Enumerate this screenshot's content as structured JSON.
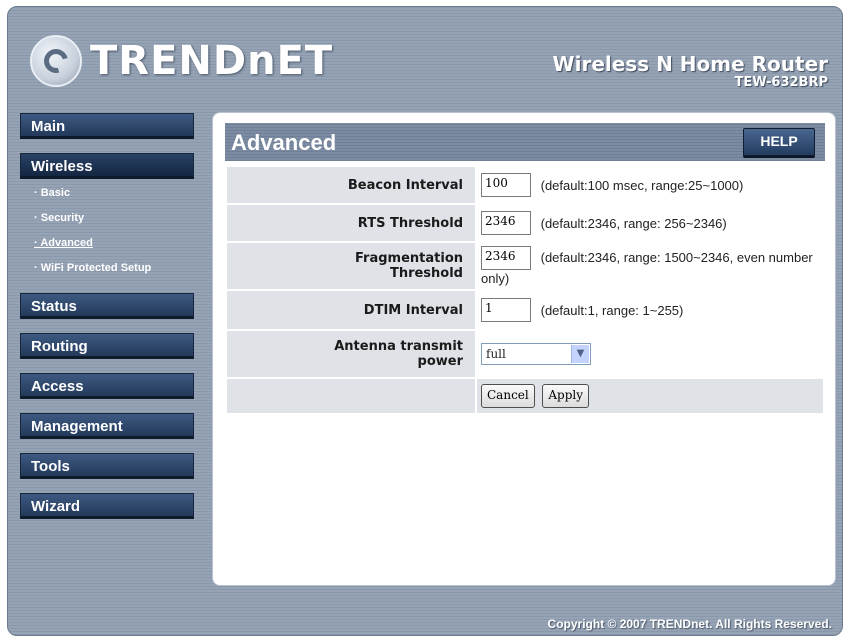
{
  "brand": {
    "logo_text": "TRENDnET",
    "product_name": "Wireless N Home Router",
    "model": "TEW-632BRP"
  },
  "sidebar": {
    "items": [
      {
        "label": "Main"
      },
      {
        "label": "Wireless",
        "sub": [
          "Basic",
          "Security",
          "Advanced",
          "WiFi Protected Setup"
        ]
      },
      {
        "label": "Status"
      },
      {
        "label": "Routing"
      },
      {
        "label": "Access"
      },
      {
        "label": "Management"
      },
      {
        "label": "Tools"
      },
      {
        "label": "Wizard"
      }
    ]
  },
  "panel": {
    "title": "Advanced",
    "help_label": "HELP"
  },
  "settings": [
    {
      "label": "Beacon Interval",
      "value": "100",
      "hint": "(default:100 msec, range:25~1000)"
    },
    {
      "label": "RTS Threshold",
      "value": "2346",
      "hint": "(default:2346, range: 256~2346)"
    },
    {
      "label": "Fragmentation Threshold",
      "value": "2346",
      "hint": "(default:2346, range: 1500~2346, even number only)"
    },
    {
      "label": "DTIM Interval",
      "value": "1",
      "hint": "(default:1, range: 1~255)"
    },
    {
      "label": "Antenna transmit power",
      "value": "full"
    }
  ],
  "actions": {
    "cancel": "Cancel",
    "apply": "Apply"
  },
  "footer": {
    "copyright": "Copyright © 2007 TRENDnet. All Rights Reserved."
  },
  "colors": {
    "nav_button": "#2b4468",
    "panel_bg": "#ffffff",
    "label_cell": "#dfe3e8"
  }
}
